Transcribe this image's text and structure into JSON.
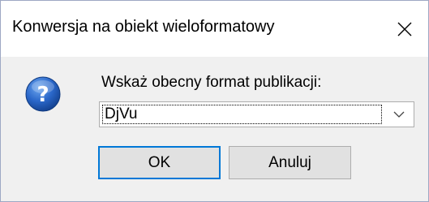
{
  "window": {
    "title": "Konwersja na obiekt wieloformatowy",
    "close_icon": "close-icon"
  },
  "prompt": {
    "icon": "question-icon",
    "label": "Wskaż obecny format publikacji:"
  },
  "format_select": {
    "selected": "DjVu",
    "arrow_icon": "chevron-down-icon"
  },
  "buttons": {
    "ok_label": "OK",
    "cancel_label": "Anuluj"
  },
  "colors": {
    "accent": "#0078d7",
    "icon_blue": "#1e5bb8"
  }
}
